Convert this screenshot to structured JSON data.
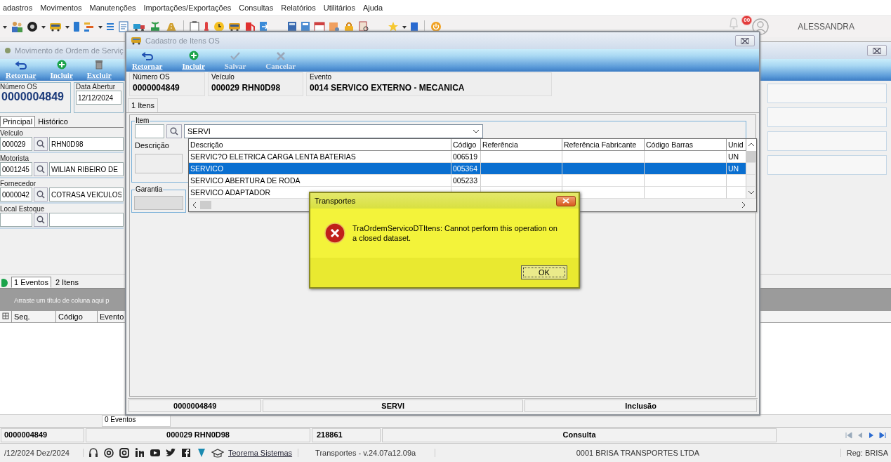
{
  "menu_bar": {
    "items": [
      "adastros",
      "Movimentos",
      "Manutenções",
      "Importações/Exportações",
      "Consultas",
      "Relatórios",
      "Utilitários",
      "Ajuda"
    ]
  },
  "top_bar": {
    "notification_badge": "00",
    "user_name": "ALESSANDRA"
  },
  "order_window": {
    "title": "Movimento de Ordem de Serviç",
    "toolbar": [
      {
        "label": "Retornar",
        "kind": "back"
      },
      {
        "label": "Incluir",
        "kind": "add"
      },
      {
        "label": "Excluir",
        "kind": "delete"
      }
    ],
    "numero_os": {
      "label": "Número OS",
      "value": "0000004849"
    },
    "data_abertura": {
      "label": "Data Abertur",
      "value": "12/12/2024"
    },
    "tabs": [
      {
        "label": "Principal",
        "selected": true
      },
      {
        "label": "Histórico",
        "selected": false
      }
    ],
    "fields": [
      {
        "label": "Veículo",
        "code": "000029",
        "name": "RHN0D98"
      },
      {
        "label": "Motorista",
        "code": "0001245",
        "name": "WILIAN RIBEIRO DE"
      },
      {
        "label": "Fornecedor",
        "code": "0000042",
        "name": "COTRASA VEICULOS"
      },
      {
        "label": "Local Estoque"
      }
    ],
    "lower_tabs": [
      {
        "label": "1 Eventos",
        "selected": true
      },
      {
        "label": "2 Itens",
        "selected": false
      }
    ],
    "group_hint": "Arraste um título de coluna aqui p",
    "grid_columns": [
      "Seq.",
      "Código",
      "Evento"
    ],
    "events_count": "0 Eventos",
    "status_bar": [
      "0000004849",
      "000029 RHN0D98",
      "218861",
      "Consulta"
    ]
  },
  "items_window": {
    "title": "Cadastro de Itens OS",
    "toolbar": [
      {
        "label": "Retornar",
        "kind": "back",
        "disabled": false
      },
      {
        "label": "Incluir",
        "kind": "add",
        "disabled": false
      },
      {
        "label": "Salvar",
        "kind": "save",
        "disabled": true
      },
      {
        "label": "Cancelar",
        "kind": "cancel",
        "disabled": true
      }
    ],
    "header": [
      {
        "label": "Número OS",
        "value": "0000004849"
      },
      {
        "label": "Veículo",
        "value": "000029 RHN0D98"
      },
      {
        "label": "Evento",
        "value": "0014 SERVICO EXTERNO - MECANICA"
      }
    ],
    "tabs": [
      {
        "label": "1 Itens",
        "selected": true
      }
    ],
    "item_group": {
      "title": "Item",
      "search_value": "SERVI",
      "description_label": "Descrição",
      "warranty_label": "Garantia"
    },
    "dropdown": {
      "columns": [
        "Descrição",
        "Código",
        "Referência",
        "Referência Fabricante",
        "Código Barras",
        "Unid"
      ],
      "rows": [
        {
          "description": "SERVIC?O ELETRICA CARGA LENTA BATERIAS",
          "code": "006519",
          "unit": "UN",
          "selected": false
        },
        {
          "description": "SERVICO",
          "code": "005364",
          "unit": "UN",
          "selected": true
        },
        {
          "description": "SERVICO ABERTURA DE RODA",
          "code": "005233",
          "selected": false
        },
        {
          "description": "SERVICO ADAPTADOR",
          "selected": false
        }
      ]
    },
    "status_bar": [
      "0000004849",
      "SERVI",
      "Inclusão"
    ]
  },
  "dialog": {
    "title": "Transportes",
    "message": "TraOrdemServicoDTItens: Cannot perform this operation on a closed dataset.",
    "button": "OK"
  },
  "footer": {
    "date": "/12/2024 Dez/2024",
    "link": "Teorema Sistemas",
    "version": "Transportes - v.24.07a12.09a",
    "company": "0001 BRISA TRANSPORTES LTDA",
    "registration": "Reg: BRISA"
  }
}
